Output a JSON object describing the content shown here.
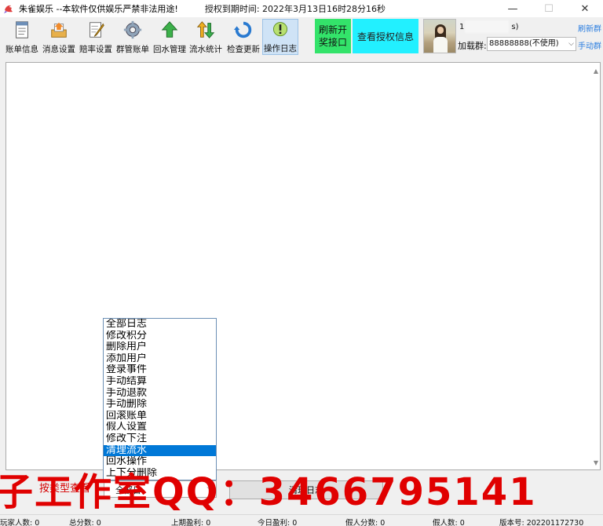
{
  "window": {
    "title": "朱雀娱乐 --本软件仅供娱乐严禁非法用途!",
    "license": "授权到期时间: 2022年3月13日16时28分16秒",
    "controls": {
      "minimize": "—",
      "maximize": "☐",
      "close": "✕"
    }
  },
  "toolbar": {
    "items": [
      {
        "label": "账单信息",
        "icon": "ledger-icon"
      },
      {
        "label": "消息设置",
        "icon": "message-tray-icon"
      },
      {
        "label": "赔率设置",
        "icon": "notepad-pencil-icon"
      },
      {
        "label": "群管账单",
        "icon": "gear-icon"
      },
      {
        "label": "回水管理",
        "icon": "green-arrow-up-icon"
      },
      {
        "label": "流水统计",
        "icon": "swap-arrows-icon"
      },
      {
        "label": "检查更新",
        "icon": "refresh-icon"
      },
      {
        "label": "操作日志",
        "icon": "warning-log-icon"
      }
    ],
    "active_index": 7,
    "refresh_lottery": "刷新开奖接口",
    "refresh_lottery_lines": [
      "刷新开",
      "奖接口"
    ],
    "view_license": "查看授权信息"
  },
  "user": {
    "name_start": "1",
    "name_end": "s)",
    "group_label": "加载群:",
    "group_value": "88888888(不使用)",
    "refresh_group": "刷新群",
    "manual_group": "手动群"
  },
  "log_filter": {
    "options": [
      "全部日志",
      "修改积分",
      "删除用户",
      "添加用户",
      "登录事件",
      "手动结算",
      "手动退款",
      "手动删除",
      "回滚账单",
      "假人设置",
      "修改下注",
      "清理流水",
      "回水操作",
      "上下分删除"
    ],
    "highlighted": "清理流水",
    "selected_value": "全部日",
    "hint": "按类型查看",
    "clear_button": "清理日志"
  },
  "watermark": "子工作室QQ：3466795141",
  "status": {
    "players": "玩家人数: 0",
    "total_points": "总分数: 0",
    "last_profit": "上期盈利: 0",
    "today_profit": "今日盈利: 0",
    "bot_points": "假人分数: 0",
    "bot_count": "假人数: 0",
    "version": "版本号: 202201172730"
  },
  "colors": {
    "accent_green": "#33e36a",
    "accent_cyan": "#22f0ff",
    "selection_blue": "#0078d7",
    "watermark_red": "#e00000",
    "link_blue": "#2b7ee0"
  }
}
